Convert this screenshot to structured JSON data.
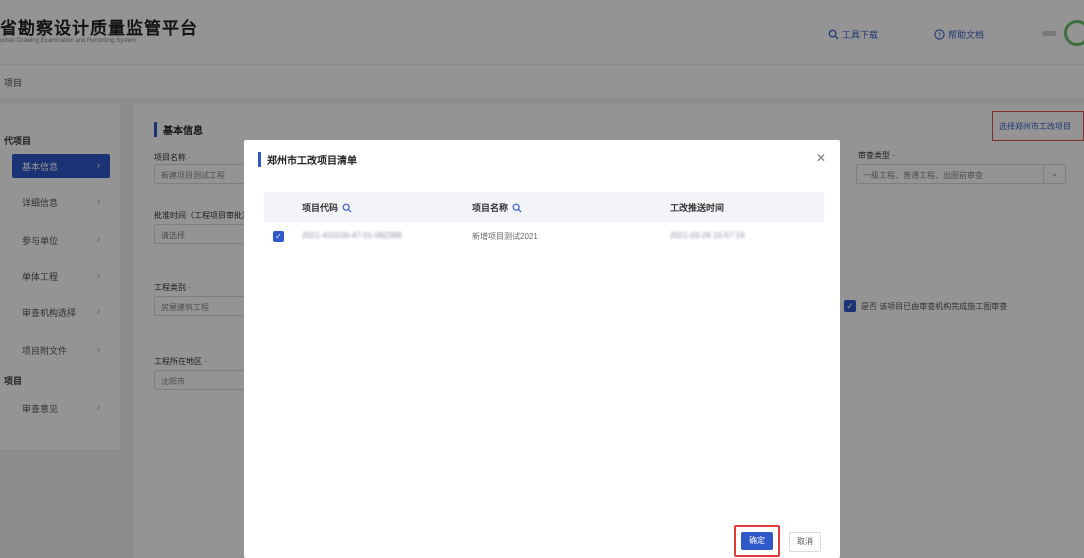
{
  "header": {
    "title": "省勘察设计质量监管平台",
    "subtitle": "urban Drawing Examination and Recording System",
    "tool_download": "工具下载",
    "help_docs": "帮助文档"
  },
  "breadcrumb": {
    "text": "项目"
  },
  "sidebar": {
    "group1": "代项目",
    "items": [
      {
        "label": "基本信息",
        "active": true
      },
      {
        "label": "详细信息"
      },
      {
        "label": "参与单位"
      },
      {
        "label": "单体工程"
      },
      {
        "label": "审查机构选择"
      },
      {
        "label": "项目附文件"
      }
    ],
    "group2": "项目",
    "items2": [
      {
        "label": "审查意见"
      }
    ]
  },
  "main": {
    "section_title": "基本信息",
    "fields": {
      "project_name_label": "项目名称 ·",
      "project_name_value": "新建项目测试工程",
      "approval_time_label": "批准时间（工程项目审批）",
      "approval_time_value": "请选择",
      "project_type_label": "工程类别 ·",
      "project_type_value": "房屋建筑工程",
      "project_location_label": "工程所在地区 ·",
      "project_location_value": "沈阳市",
      "review_type_label": "审查类型 ·",
      "review_type_value": "一级工程、普通工程、出图前审查"
    },
    "sync_link": "选择郑州市工改项目",
    "checkbox_text": "是否 该项目已由审查机构完成施工图审查"
  },
  "modal": {
    "title": "郑州市工改项目清单",
    "columns": [
      "项目代码",
      "项目名称",
      "工改推送时间"
    ],
    "rows": [
      {
        "checked": true,
        "code": "2021-410100-47-01-082388",
        "name": "新增项目测试2021",
        "time": "2021-03-26 15:57:19"
      }
    ],
    "confirm": "确定",
    "cancel": "取消"
  },
  "colors": {
    "primary": "#2f58c9",
    "highlight": "#e03a3a"
  }
}
